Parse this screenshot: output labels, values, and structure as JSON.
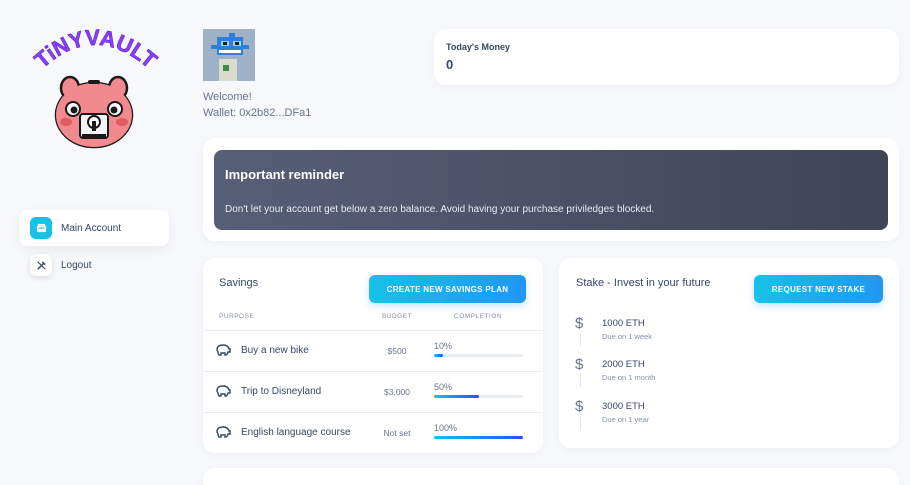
{
  "app": {
    "logo_text": "TiNYVAULT"
  },
  "sidebar": {
    "items": [
      {
        "label": "Main Account",
        "icon": "wallet-icon"
      },
      {
        "label": "Logout",
        "icon": "tools-icon"
      }
    ]
  },
  "user": {
    "welcome": "Welcome!",
    "wallet": "Wallet: 0x2b82...DFa1"
  },
  "money": {
    "label": "Today's Money",
    "value": "0"
  },
  "reminder": {
    "title": "Important reminder",
    "text": "Don't let your account get below a zero balance. Avoid having your purchase priviledges blocked."
  },
  "savings": {
    "title": "Savings",
    "button": "CREATE NEW SAVINGS PLAN",
    "columns": [
      "PURPOSE",
      "BUDGET",
      "COMPLETION"
    ],
    "rows": [
      {
        "purpose": "Buy a new bike",
        "budget": "$500",
        "completion": "10%",
        "progress": 0.1
      },
      {
        "purpose": "Trip to Disneyland",
        "budget": "$3,000",
        "completion": "50%",
        "progress": 0.5
      },
      {
        "purpose": "English language course",
        "budget": "Not set",
        "completion": "100%",
        "progress": 1.0
      }
    ]
  },
  "stake": {
    "title": "Stake - Invest in your future",
    "button": "REQUEST NEW STAKE",
    "items": [
      {
        "amount": "1000 ETH",
        "due": "Due on 1 week"
      },
      {
        "amount": "2000 ETH",
        "due": "Due on 1 month"
      },
      {
        "amount": "3000 ETH",
        "due": "Due on 1 year"
      }
    ]
  },
  "colors": {
    "accent": "#17c1e8",
    "accent_end": "#2196f3",
    "text": "#344767",
    "logo_purple": "#8a3ffc",
    "pig_pink": "#f08a8f"
  }
}
